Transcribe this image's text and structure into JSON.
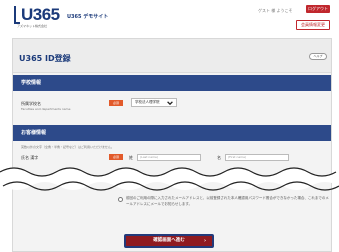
{
  "header": {
    "logo": "U365",
    "logo_sub": "アズマネット株式会社",
    "site_name": "U365 デモサイト",
    "user": "ゲスト 様 ようこそ",
    "logout_label": "ログアウト",
    "member_label": "会員情報変更"
  },
  "page": {
    "title": "U365 ID登録",
    "help_label": "ヘルプ"
  },
  "school": {
    "section_title": "学校情報",
    "field_label": "所属学校名",
    "field_sublabel": "Faculties and departments name",
    "required": "必須",
    "select_value": "学校法人理学院"
  },
  "customer": {
    "section_title": "お客様情報",
    "note": "英数以外の文字（全角・半角・記号など）はご利用いただけません。",
    "name_label": "氏名 漢字",
    "required": "必須",
    "last_label": "姓",
    "last_placeholder": "(Last name)",
    "first_label": "名",
    "first_placeholder": "(First name)"
  },
  "consent": {
    "text": "前回のご利用の際に入力されたメールアドレスと、以前登録された本人確認用パスワード照合ができなかった場合、これまでのメールアドレスにメールでお知らせします。"
  },
  "submit": {
    "label": "確認画面へ進む",
    "arrow": "›"
  },
  "colors": {
    "brand": "#1b3a7a",
    "section": "#2d4a8a",
    "accent": "#c0272d",
    "required": "#e25a2a"
  }
}
